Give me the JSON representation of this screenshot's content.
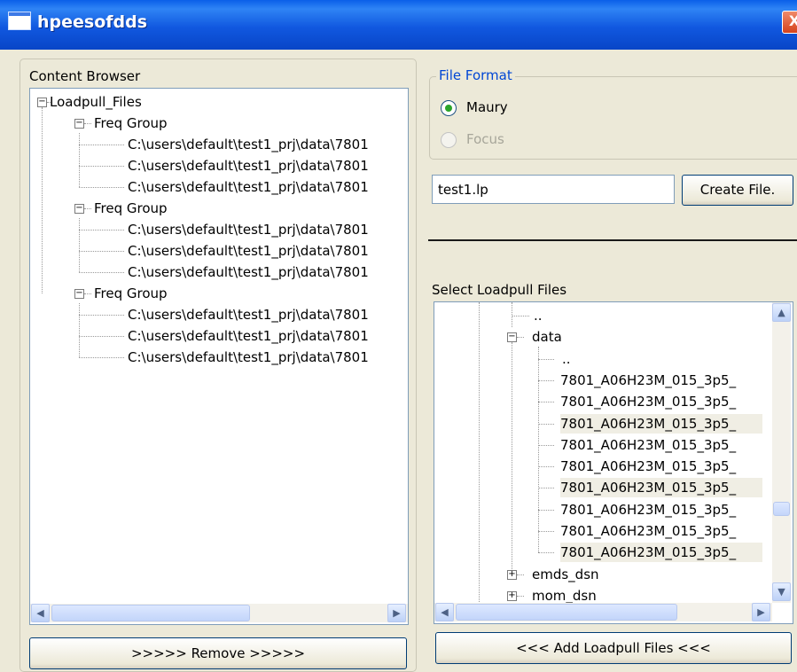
{
  "window": {
    "title": "hpeesofdds",
    "close_glyph": "X"
  },
  "content_browser": {
    "label": "Content Browser",
    "root": "Loadpull_Files",
    "groups": [
      {
        "label": "Freq Group",
        "files": [
          "C:\\users\\default\\test1_prj\\data\\7801",
          "C:\\users\\default\\test1_prj\\data\\7801",
          "C:\\users\\default\\test1_prj\\data\\7801"
        ]
      },
      {
        "label": "Freq Group",
        "files": [
          "C:\\users\\default\\test1_prj\\data\\7801",
          "C:\\users\\default\\test1_prj\\data\\7801",
          "C:\\users\\default\\test1_prj\\data\\7801"
        ]
      },
      {
        "label": "Freq Group",
        "files": [
          "C:\\users\\default\\test1_prj\\data\\7801",
          "C:\\users\\default\\test1_prj\\data\\7801",
          "C:\\users\\default\\test1_prj\\data\\7801"
        ]
      }
    ],
    "remove_button": ">>>>> Remove >>>>>"
  },
  "file_format": {
    "label": "File Format",
    "options": [
      {
        "label": "Maury",
        "selected": true,
        "enabled": true
      },
      {
        "label": "Focus",
        "selected": false,
        "enabled": false
      }
    ]
  },
  "filename": {
    "value": "test1.lp"
  },
  "create_button": "Create File.",
  "select_files": {
    "label": "Select Loadpull Files",
    "parent_dots": "..",
    "folder": "data",
    "data_dots": "..",
    "files": [
      {
        "name": "7801_A06H23M_015_3p5_",
        "highlighted": false
      },
      {
        "name": "7801_A06H23M_015_3p5_",
        "highlighted": false
      },
      {
        "name": "7801_A06H23M_015_3p5_",
        "highlighted": true
      },
      {
        "name": "7801_A06H23M_015_3p5_",
        "highlighted": false
      },
      {
        "name": "7801_A06H23M_015_3p5_",
        "highlighted": false
      },
      {
        "name": "7801_A06H23M_015_3p5_",
        "highlighted": true
      },
      {
        "name": "7801_A06H23M_015_3p5_",
        "highlighted": false
      },
      {
        "name": "7801_A06H23M_015_3p5_",
        "highlighted": false
      },
      {
        "name": "7801_A06H23M_015_3p5_",
        "highlighted": true
      }
    ],
    "sibling_folders": [
      "emds_dsn",
      "mom_dsn"
    ],
    "add_button": "<<< Add Loadpull Files <<<"
  },
  "icons": {
    "collapse": "minus-box-icon",
    "expand": "plus-box-icon",
    "scroll_left": "arrow-left-icon",
    "scroll_right": "arrow-right-icon",
    "scroll_up": "arrow-up-icon",
    "scroll_down": "arrow-down-icon"
  },
  "colors": {
    "title_bar": "#0a5fe8",
    "dialog_bg": "#ece9d8",
    "radio_selected": "#2aa42a",
    "group_label": "#0046d5"
  }
}
